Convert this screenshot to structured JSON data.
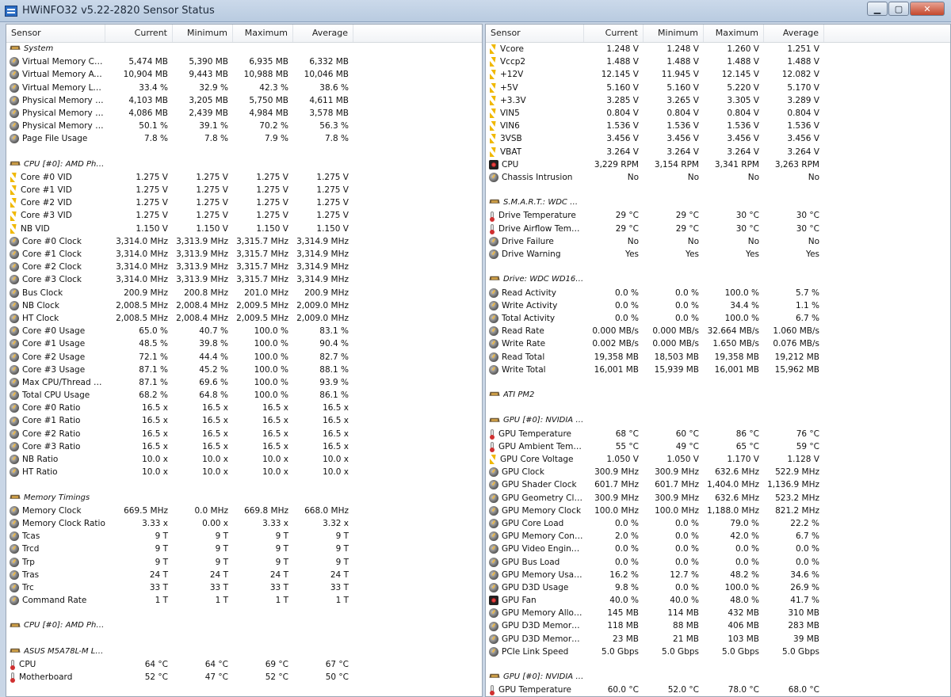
{
  "window": {
    "title": "HWiNFO32 v5.22-2820 Sensor Status",
    "buttons": {
      "minimize": "▁",
      "maximize": "▢",
      "close": "✕"
    }
  },
  "columns": [
    "Sensor",
    "Current",
    "Minimum",
    "Maximum",
    "Average"
  ],
  "left_rows": [
    {
      "type": "section",
      "icon": "chip",
      "label": "System"
    },
    {
      "type": "data",
      "icon": "gauge",
      "label": "Virtual Memory Com...",
      "cur": "5,474 MB",
      "min": "5,390 MB",
      "max": "6,935 MB",
      "avg": "6,332 MB"
    },
    {
      "type": "data",
      "icon": "gauge",
      "label": "Virtual Memory Avai...",
      "cur": "10,904 MB",
      "min": "9,443 MB",
      "max": "10,988 MB",
      "avg": "10,046 MB"
    },
    {
      "type": "data",
      "icon": "gauge",
      "label": "Virtual Memory Load",
      "cur": "33.4 %",
      "min": "32.9 %",
      "max": "42.3 %",
      "avg": "38.6 %"
    },
    {
      "type": "data",
      "icon": "gauge",
      "label": "Physical Memory Used",
      "cur": "4,103 MB",
      "min": "3,205 MB",
      "max": "5,750 MB",
      "avg": "4,611 MB"
    },
    {
      "type": "data",
      "icon": "gauge",
      "label": "Physical Memory Av...",
      "cur": "4,086 MB",
      "min": "2,439 MB",
      "max": "4,984 MB",
      "avg": "3,578 MB"
    },
    {
      "type": "data",
      "icon": "gauge",
      "label": "Physical Memory Load",
      "cur": "50.1 %",
      "min": "39.1 %",
      "max": "70.2 %",
      "avg": "56.3 %"
    },
    {
      "type": "data",
      "icon": "gauge",
      "label": "Page File Usage",
      "cur": "7.8 %",
      "min": "7.8 %",
      "max": "7.9 %",
      "avg": "7.8 %"
    },
    {
      "type": "blank"
    },
    {
      "type": "section",
      "icon": "chip",
      "label": "CPU [#0]: AMD Phen..."
    },
    {
      "type": "data",
      "icon": "volt",
      "label": "Core #0 VID",
      "cur": "1.275 V",
      "min": "1.275 V",
      "max": "1.275 V",
      "avg": "1.275 V"
    },
    {
      "type": "data",
      "icon": "volt",
      "label": "Core #1 VID",
      "cur": "1.275 V",
      "min": "1.275 V",
      "max": "1.275 V",
      "avg": "1.275 V"
    },
    {
      "type": "data",
      "icon": "volt",
      "label": "Core #2 VID",
      "cur": "1.275 V",
      "min": "1.275 V",
      "max": "1.275 V",
      "avg": "1.275 V"
    },
    {
      "type": "data",
      "icon": "volt",
      "label": "Core #3 VID",
      "cur": "1.275 V",
      "min": "1.275 V",
      "max": "1.275 V",
      "avg": "1.275 V"
    },
    {
      "type": "data",
      "icon": "volt",
      "label": "NB VID",
      "cur": "1.150 V",
      "min": "1.150 V",
      "max": "1.150 V",
      "avg": "1.150 V"
    },
    {
      "type": "data",
      "icon": "gauge",
      "label": "Core #0 Clock",
      "cur": "3,314.0 MHz",
      "min": "3,313.9 MHz",
      "max": "3,315.7 MHz",
      "avg": "3,314.9 MHz"
    },
    {
      "type": "data",
      "icon": "gauge",
      "label": "Core #1 Clock",
      "cur": "3,314.0 MHz",
      "min": "3,313.9 MHz",
      "max": "3,315.7 MHz",
      "avg": "3,314.9 MHz"
    },
    {
      "type": "data",
      "icon": "gauge",
      "label": "Core #2 Clock",
      "cur": "3,314.0 MHz",
      "min": "3,313.9 MHz",
      "max": "3,315.7 MHz",
      "avg": "3,314.9 MHz"
    },
    {
      "type": "data",
      "icon": "gauge",
      "label": "Core #3 Clock",
      "cur": "3,314.0 MHz",
      "min": "3,313.9 MHz",
      "max": "3,315.7 MHz",
      "avg": "3,314.9 MHz"
    },
    {
      "type": "data",
      "icon": "gauge",
      "label": "Bus Clock",
      "cur": "200.9 MHz",
      "min": "200.8 MHz",
      "max": "201.0 MHz",
      "avg": "200.9 MHz"
    },
    {
      "type": "data",
      "icon": "gauge",
      "label": "NB Clock",
      "cur": "2,008.5 MHz",
      "min": "2,008.4 MHz",
      "max": "2,009.5 MHz",
      "avg": "2,009.0 MHz"
    },
    {
      "type": "data",
      "icon": "gauge",
      "label": "HT Clock",
      "cur": "2,008.5 MHz",
      "min": "2,008.4 MHz",
      "max": "2,009.5 MHz",
      "avg": "2,009.0 MHz"
    },
    {
      "type": "data",
      "icon": "gauge",
      "label": "Core #0 Usage",
      "cur": "65.0 %",
      "min": "40.7 %",
      "max": "100.0 %",
      "avg": "83.1 %"
    },
    {
      "type": "data",
      "icon": "gauge",
      "label": "Core #1 Usage",
      "cur": "48.5 %",
      "min": "39.8 %",
      "max": "100.0 %",
      "avg": "90.4 %"
    },
    {
      "type": "data",
      "icon": "gauge",
      "label": "Core #2 Usage",
      "cur": "72.1 %",
      "min": "44.4 %",
      "max": "100.0 %",
      "avg": "82.7 %"
    },
    {
      "type": "data",
      "icon": "gauge",
      "label": "Core #3 Usage",
      "cur": "87.1 %",
      "min": "45.2 %",
      "max": "100.0 %",
      "avg": "88.1 %"
    },
    {
      "type": "data",
      "icon": "gauge",
      "label": "Max CPU/Thread U...",
      "cur": "87.1 %",
      "min": "69.6 %",
      "max": "100.0 %",
      "avg": "93.9 %"
    },
    {
      "type": "data",
      "icon": "gauge",
      "label": "Total CPU Usage",
      "cur": "68.2 %",
      "min": "64.8 %",
      "max": "100.0 %",
      "avg": "86.1 %"
    },
    {
      "type": "data",
      "icon": "gauge",
      "label": "Core #0 Ratio",
      "cur": "16.5 x",
      "min": "16.5 x",
      "max": "16.5 x",
      "avg": "16.5 x"
    },
    {
      "type": "data",
      "icon": "gauge",
      "label": "Core #1 Ratio",
      "cur": "16.5 x",
      "min": "16.5 x",
      "max": "16.5 x",
      "avg": "16.5 x"
    },
    {
      "type": "data",
      "icon": "gauge",
      "label": "Core #2 Ratio",
      "cur": "16.5 x",
      "min": "16.5 x",
      "max": "16.5 x",
      "avg": "16.5 x"
    },
    {
      "type": "data",
      "icon": "gauge",
      "label": "Core #3 Ratio",
      "cur": "16.5 x",
      "min": "16.5 x",
      "max": "16.5 x",
      "avg": "16.5 x"
    },
    {
      "type": "data",
      "icon": "gauge",
      "label": "NB Ratio",
      "cur": "10.0 x",
      "min": "10.0 x",
      "max": "10.0 x",
      "avg": "10.0 x"
    },
    {
      "type": "data",
      "icon": "gauge",
      "label": "HT Ratio",
      "cur": "10.0 x",
      "min": "10.0 x",
      "max": "10.0 x",
      "avg": "10.0 x"
    },
    {
      "type": "blank"
    },
    {
      "type": "section",
      "icon": "chip",
      "label": "Memory Timings"
    },
    {
      "type": "data",
      "icon": "gauge",
      "label": "Memory Clock",
      "cur": "669.5 MHz",
      "min": "0.0 MHz",
      "max": "669.8 MHz",
      "avg": "668.0 MHz"
    },
    {
      "type": "data",
      "icon": "gauge",
      "label": "Memory Clock Ratio",
      "cur": "3.33 x",
      "min": "0.00 x",
      "max": "3.33 x",
      "avg": "3.32 x"
    },
    {
      "type": "data",
      "icon": "gauge",
      "label": "Tcas",
      "cur": "9 T",
      "min": "9 T",
      "max": "9 T",
      "avg": "9 T"
    },
    {
      "type": "data",
      "icon": "gauge",
      "label": "Trcd",
      "cur": "9 T",
      "min": "9 T",
      "max": "9 T",
      "avg": "9 T"
    },
    {
      "type": "data",
      "icon": "gauge",
      "label": "Trp",
      "cur": "9 T",
      "min": "9 T",
      "max": "9 T",
      "avg": "9 T"
    },
    {
      "type": "data",
      "icon": "gauge",
      "label": "Tras",
      "cur": "24 T",
      "min": "24 T",
      "max": "24 T",
      "avg": "24 T"
    },
    {
      "type": "data",
      "icon": "gauge",
      "label": "Trc",
      "cur": "33 T",
      "min": "33 T",
      "max": "33 T",
      "avg": "33 T"
    },
    {
      "type": "data",
      "icon": "gauge",
      "label": "Command Rate",
      "cur": "1 T",
      "min": "1 T",
      "max": "1 T",
      "avg": "1 T"
    },
    {
      "type": "blank"
    },
    {
      "type": "section",
      "icon": "chip",
      "label": "CPU [#0]: AMD Phen..."
    },
    {
      "type": "blank"
    },
    {
      "type": "section",
      "icon": "chip",
      "label": "ASUS M5A78L-M LX (..."
    },
    {
      "type": "data",
      "icon": "temp",
      "label": "CPU",
      "cur": "64 °C",
      "min": "64 °C",
      "max": "69 °C",
      "avg": "67 °C"
    },
    {
      "type": "data",
      "icon": "temp",
      "label": "Motherboard",
      "cur": "52 °C",
      "min": "47 °C",
      "max": "52 °C",
      "avg": "50 °C"
    }
  ],
  "right_rows": [
    {
      "type": "data",
      "icon": "volt",
      "label": "Vcore",
      "cur": "1.248 V",
      "min": "1.248 V",
      "max": "1.260 V",
      "avg": "1.251 V"
    },
    {
      "type": "data",
      "icon": "volt",
      "label": "Vccp2",
      "cur": "1.488 V",
      "min": "1.488 V",
      "max": "1.488 V",
      "avg": "1.488 V"
    },
    {
      "type": "data",
      "icon": "volt",
      "label": "+12V",
      "cur": "12.145 V",
      "min": "11.945 V",
      "max": "12.145 V",
      "avg": "12.082 V"
    },
    {
      "type": "data",
      "icon": "volt",
      "label": "+5V",
      "cur": "5.160 V",
      "min": "5.160 V",
      "max": "5.220 V",
      "avg": "5.170 V"
    },
    {
      "type": "data",
      "icon": "volt",
      "label": "+3.3V",
      "cur": "3.285 V",
      "min": "3.265 V",
      "max": "3.305 V",
      "avg": "3.289 V"
    },
    {
      "type": "data",
      "icon": "volt",
      "label": "VIN5",
      "cur": "0.804 V",
      "min": "0.804 V",
      "max": "0.804 V",
      "avg": "0.804 V"
    },
    {
      "type": "data",
      "icon": "volt",
      "label": "VIN6",
      "cur": "1.536 V",
      "min": "1.536 V",
      "max": "1.536 V",
      "avg": "1.536 V"
    },
    {
      "type": "data",
      "icon": "volt",
      "label": "3VSB",
      "cur": "3.456 V",
      "min": "3.456 V",
      "max": "3.456 V",
      "avg": "3.456 V"
    },
    {
      "type": "data",
      "icon": "volt",
      "label": "VBAT",
      "cur": "3.264 V",
      "min": "3.264 V",
      "max": "3.264 V",
      "avg": "3.264 V"
    },
    {
      "type": "data",
      "icon": "fan",
      "label": "CPU",
      "cur": "3,229 RPM",
      "min": "3,154 RPM",
      "max": "3,341 RPM",
      "avg": "3,263 RPM"
    },
    {
      "type": "data",
      "icon": "gauge",
      "label": "Chassis Intrusion",
      "cur": "No",
      "min": "No",
      "max": "No",
      "avg": "No"
    },
    {
      "type": "blank"
    },
    {
      "type": "section",
      "icon": "chip",
      "label": "S.M.A.R.T.: WDC W..."
    },
    {
      "type": "data",
      "icon": "temp",
      "label": "Drive Temperature",
      "cur": "29 °C",
      "min": "29 °C",
      "max": "30 °C",
      "avg": "30 °C"
    },
    {
      "type": "data",
      "icon": "temp",
      "label": "Drive Airflow Temp...",
      "cur": "29 °C",
      "min": "29 °C",
      "max": "30 °C",
      "avg": "30 °C"
    },
    {
      "type": "data",
      "icon": "gauge",
      "label": "Drive Failure",
      "cur": "No",
      "min": "No",
      "max": "No",
      "avg": "No"
    },
    {
      "type": "data",
      "icon": "gauge",
      "label": "Drive Warning",
      "cur": "Yes",
      "min": "Yes",
      "max": "Yes",
      "avg": "Yes"
    },
    {
      "type": "blank"
    },
    {
      "type": "section",
      "icon": "chip",
      "label": "Drive: WDC WD1600..."
    },
    {
      "type": "data",
      "icon": "gauge",
      "label": "Read Activity",
      "cur": "0.0 %",
      "min": "0.0 %",
      "max": "100.0 %",
      "avg": "5.7 %"
    },
    {
      "type": "data",
      "icon": "gauge",
      "label": "Write Activity",
      "cur": "0.0 %",
      "min": "0.0 %",
      "max": "34.4 %",
      "avg": "1.1 %"
    },
    {
      "type": "data",
      "icon": "gauge",
      "label": "Total Activity",
      "cur": "0.0 %",
      "min": "0.0 %",
      "max": "100.0 %",
      "avg": "6.7 %"
    },
    {
      "type": "data",
      "icon": "gauge",
      "label": "Read Rate",
      "cur": "0.000 MB/s",
      "min": "0.000 MB/s",
      "max": "32.664 MB/s",
      "avg": "1.060 MB/s"
    },
    {
      "type": "data",
      "icon": "gauge",
      "label": "Write Rate",
      "cur": "0.002 MB/s",
      "min": "0.000 MB/s",
      "max": "1.650 MB/s",
      "avg": "0.076 MB/s"
    },
    {
      "type": "data",
      "icon": "gauge",
      "label": "Read Total",
      "cur": "19,358 MB",
      "min": "18,503 MB",
      "max": "19,358 MB",
      "avg": "19,212 MB"
    },
    {
      "type": "data",
      "icon": "gauge",
      "label": "Write Total",
      "cur": "16,001 MB",
      "min": "15,939 MB",
      "max": "16,001 MB",
      "avg": "15,962 MB"
    },
    {
      "type": "blank"
    },
    {
      "type": "section",
      "icon": "chip",
      "label": "ATI PM2"
    },
    {
      "type": "blank"
    },
    {
      "type": "section",
      "icon": "chip",
      "label": "GPU [#0]: NVIDIA G..."
    },
    {
      "type": "data",
      "icon": "temp",
      "label": "GPU Temperature",
      "cur": "68 °C",
      "min": "60 °C",
      "max": "86 °C",
      "avg": "76 °C"
    },
    {
      "type": "data",
      "icon": "temp",
      "label": "GPU Ambient Temp...",
      "cur": "55 °C",
      "min": "49 °C",
      "max": "65 °C",
      "avg": "59 °C"
    },
    {
      "type": "data",
      "icon": "volt",
      "label": "GPU Core Voltage",
      "cur": "1.050 V",
      "min": "1.050 V",
      "max": "1.170 V",
      "avg": "1.128 V"
    },
    {
      "type": "data",
      "icon": "gauge",
      "label": "GPU Clock",
      "cur": "300.9 MHz",
      "min": "300.9 MHz",
      "max": "632.6 MHz",
      "avg": "522.9 MHz"
    },
    {
      "type": "data",
      "icon": "gauge",
      "label": "GPU Shader Clock",
      "cur": "601.7 MHz",
      "min": "601.7 MHz",
      "max": "1,404.0 MHz",
      "avg": "1,136.9 MHz"
    },
    {
      "type": "data",
      "icon": "gauge",
      "label": "GPU Geometry Clock",
      "cur": "300.9 MHz",
      "min": "300.9 MHz",
      "max": "632.6 MHz",
      "avg": "523.2 MHz"
    },
    {
      "type": "data",
      "icon": "gauge",
      "label": "GPU Memory Clock",
      "cur": "100.0 MHz",
      "min": "100.0 MHz",
      "max": "1,188.0 MHz",
      "avg": "821.2 MHz"
    },
    {
      "type": "data",
      "icon": "gauge",
      "label": "GPU Core Load",
      "cur": "0.0 %",
      "min": "0.0 %",
      "max": "79.0 %",
      "avg": "22.2 %"
    },
    {
      "type": "data",
      "icon": "gauge",
      "label": "GPU Memory Contr...",
      "cur": "2.0 %",
      "min": "0.0 %",
      "max": "42.0 %",
      "avg": "6.7 %"
    },
    {
      "type": "data",
      "icon": "gauge",
      "label": "GPU Video Engine L...",
      "cur": "0.0 %",
      "min": "0.0 %",
      "max": "0.0 %",
      "avg": "0.0 %"
    },
    {
      "type": "data",
      "icon": "gauge",
      "label": "GPU Bus Load",
      "cur": "0.0 %",
      "min": "0.0 %",
      "max": "0.0 %",
      "avg": "0.0 %"
    },
    {
      "type": "data",
      "icon": "gauge",
      "label": "GPU Memory Usage",
      "cur": "16.2 %",
      "min": "12.7 %",
      "max": "48.2 %",
      "avg": "34.6 %"
    },
    {
      "type": "data",
      "icon": "gauge",
      "label": "GPU D3D Usage",
      "cur": "9.8 %",
      "min": "0.0 %",
      "max": "100.0 %",
      "avg": "26.9 %"
    },
    {
      "type": "data",
      "icon": "fan",
      "label": "GPU Fan",
      "cur": "40.0 %",
      "min": "40.0 %",
      "max": "48.0 %",
      "avg": "41.7 %"
    },
    {
      "type": "data",
      "icon": "gauge",
      "label": "GPU Memory Alloca...",
      "cur": "145 MB",
      "min": "114 MB",
      "max": "432 MB",
      "avg": "310 MB"
    },
    {
      "type": "data",
      "icon": "gauge",
      "label": "GPU D3D Memory D...",
      "cur": "118 MB",
      "min": "88 MB",
      "max": "406 MB",
      "avg": "283 MB"
    },
    {
      "type": "data",
      "icon": "gauge",
      "label": "GPU D3D Memory D...",
      "cur": "23 MB",
      "min": "21 MB",
      "max": "103 MB",
      "avg": "39 MB"
    },
    {
      "type": "data",
      "icon": "gauge",
      "label": "PCIe Link Speed",
      "cur": "5.0 Gbps",
      "min": "5.0 Gbps",
      "max": "5.0 Gbps",
      "avg": "5.0 Gbps"
    },
    {
      "type": "blank"
    },
    {
      "type": "section",
      "icon": "chip",
      "label": "GPU [#0]: NVIDIA G..."
    },
    {
      "type": "data",
      "icon": "temp",
      "label": "GPU Temperature",
      "cur": "60.0 °C",
      "min": "52.0 °C",
      "max": "78.0 °C",
      "avg": "68.0 °C"
    }
  ]
}
